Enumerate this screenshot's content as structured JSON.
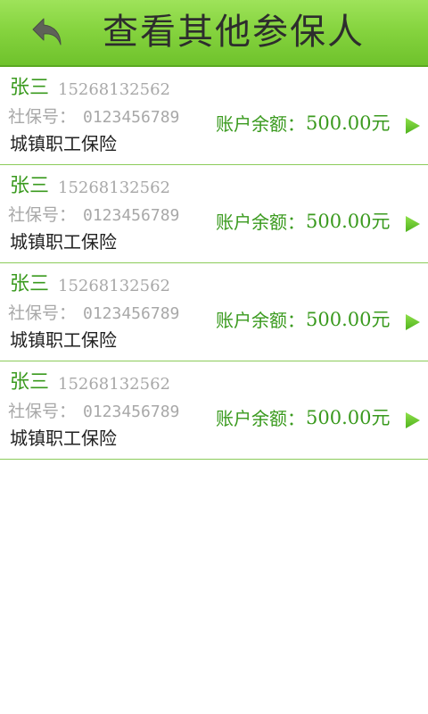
{
  "header": {
    "title": "查看其他参保人",
    "back_icon": "back-arrow-icon"
  },
  "colors": {
    "header_green": "#86d43f",
    "accent_green": "#3a9a1e",
    "divider_green": "#8ccc5a",
    "gray_text": "#a8a8a8"
  },
  "insured": [
    {
      "name": "张三",
      "phone": "15268132562",
      "ss_label": "社保号：",
      "ss_number": "0123456789",
      "insurance_type": "城镇职工保险",
      "balance_label": "账户余额：",
      "balance_value": "500.00元"
    },
    {
      "name": "张三",
      "phone": "15268132562",
      "ss_label": "社保号：",
      "ss_number": "0123456789",
      "insurance_type": "城镇职工保险",
      "balance_label": "账户余额：",
      "balance_value": "500.00元"
    },
    {
      "name": "张三",
      "phone": "15268132562",
      "ss_label": "社保号：",
      "ss_number": "0123456789",
      "insurance_type": "城镇职工保险",
      "balance_label": "账户余额：",
      "balance_value": "500.00元"
    },
    {
      "name": "张三",
      "phone": "15268132562",
      "ss_label": "社保号：",
      "ss_number": "0123456789",
      "insurance_type": "城镇职工保险",
      "balance_label": "账户余额：",
      "balance_value": "500.00元"
    }
  ]
}
